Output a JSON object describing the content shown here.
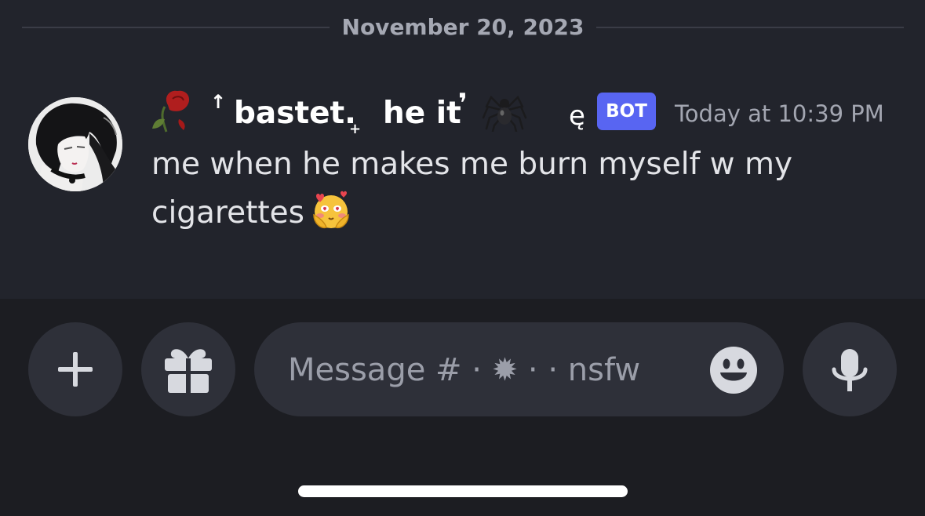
{
  "date_divider": "November 20, 2023",
  "message": {
    "name_prefix": "↑",
    "name_main": "bastet.",
    "name_sub": "+",
    "name_part2": "he it",
    "name_comma": "❜",
    "name_suffix": "ę",
    "bot_badge": "BOT",
    "timestamp": "Today at 10:39 PM",
    "text": "me when he makes me burn myself w my cigarettes"
  },
  "composer": {
    "placeholder": "Message # · ✹ ·  · nsfw",
    "add_icon": "plus-icon",
    "gift_icon": "gift-icon",
    "emoji_icon": "smiley-icon",
    "mic_icon": "microphone-icon"
  },
  "colors": {
    "chat_bg": "#22242c",
    "composer_bg": "#1c1d22",
    "bot_badge": "#5865f2"
  }
}
